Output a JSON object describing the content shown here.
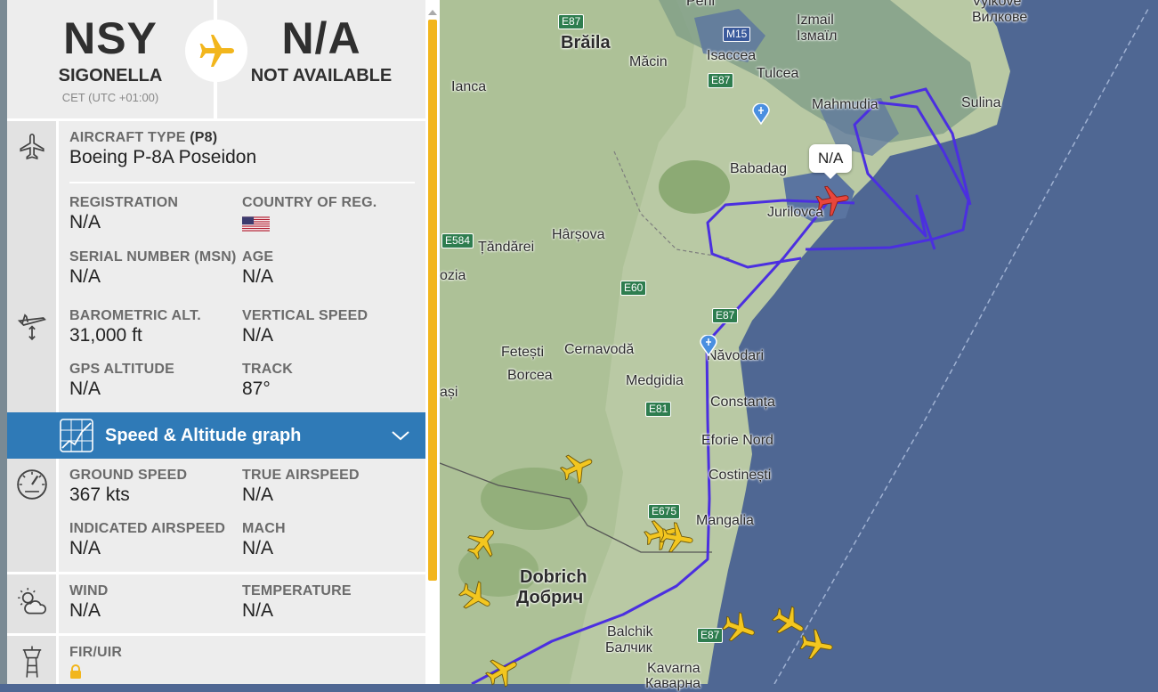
{
  "route": {
    "origin": {
      "code": "NSY",
      "city": "SIGONELLA",
      "timezone": "CET (UTC +01:00)"
    },
    "destination": {
      "code": "N/A",
      "city": "NOT AVAILABLE"
    }
  },
  "aircraft": {
    "type_label": "AIRCRAFT TYPE",
    "type_code": "(P8)",
    "type_value": "Boeing P-8A Poseidon",
    "registration_label": "REGISTRATION",
    "registration_value": "N/A",
    "country_label": "COUNTRY OF REG.",
    "country_flag": "us-flag",
    "msn_label": "SERIAL NUMBER (MSN)",
    "msn_value": "N/A",
    "age_label": "AGE",
    "age_value": "N/A"
  },
  "altitude": {
    "baro_label": "BAROMETRIC ALT.",
    "baro_value": "31,000 ft",
    "vspeed_label": "VERTICAL SPEED",
    "vspeed_value": "N/A",
    "gps_label": "GPS ALTITUDE",
    "gps_value": "N/A",
    "track_label": "TRACK",
    "track_value": "87°"
  },
  "graph": {
    "title": "Speed & Altitude graph"
  },
  "speed": {
    "ground_label": "GROUND SPEED",
    "ground_value": "367 kts",
    "tas_label": "TRUE AIRSPEED",
    "tas_value": "N/A",
    "ias_label": "INDICATED AIRSPEED",
    "ias_value": "N/A",
    "mach_label": "MACH",
    "mach_value": "N/A"
  },
  "weather": {
    "wind_label": "WIND",
    "wind_value": "N/A",
    "temp_label": "TEMPERATURE",
    "temp_value": "N/A"
  },
  "fir": {
    "label": "FIR/UIR",
    "icon": "lock-icon"
  },
  "map": {
    "callout": "N/A",
    "track_color": "#4b2fe0",
    "selected_plane_color": "#e8463c",
    "traffic_plane_color": "#f3c61f",
    "labels": {
      "peni": "Peni",
      "vylkove": "Vylkove",
      "vylkove_cyr": "Вилкове",
      "izmail": "Izmail",
      "izmail_cyr": "Ізмаїл",
      "braila": "Brăila",
      "macin": "Măcin",
      "isaccea": "Isaccea",
      "tulcea": "Tulcea",
      "ianca": "Ianca",
      "mahmudia": "Mahmudia",
      "sulina": "Sulina",
      "babadag": "Babadag",
      "jurilovca": "Jurilovca",
      "tandarei": "Țăndărei",
      "harsova": "Hârșova",
      "slobozia": "ozia",
      "fetesti": "Fetești",
      "cernavoda": "Cernavodă",
      "navodari": "Năvodari",
      "borcea": "Borcea",
      "medgidia": "Medgidia",
      "iasi": "ași",
      "constanta": "Constanța",
      "eforie": "Eforie Nord",
      "costinesti": "Costinești",
      "mangalia": "Mangalia",
      "dobrich": "Dobrich",
      "dobrich_cyr": "Добрич",
      "balchik": "Balchik",
      "balchik_cyr": "Балчик",
      "kavarna": "Kavarna",
      "kavarna_cyr": "Каварна"
    },
    "roads": {
      "e87a": "E87",
      "m15": "M15",
      "e87b": "E87",
      "e584": "E584",
      "e60": "E60",
      "e87c": "E87",
      "e81": "E81",
      "e675": "E675",
      "e87d": "E87"
    }
  }
}
